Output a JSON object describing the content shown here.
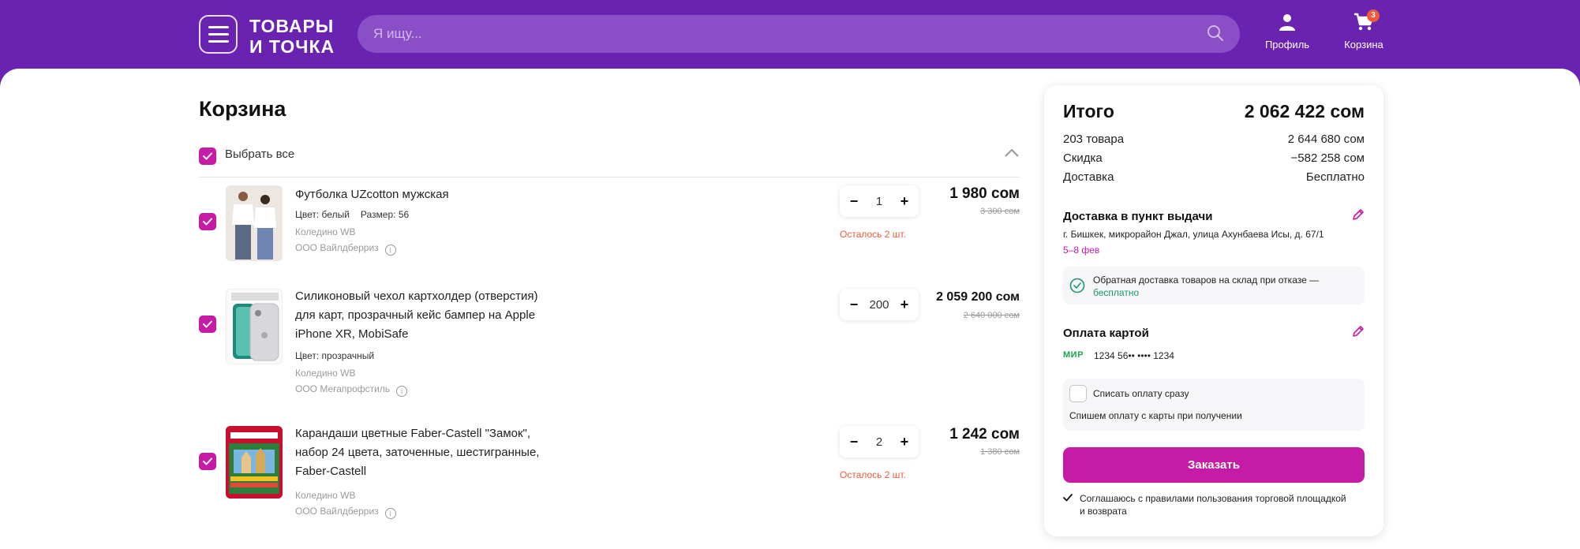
{
  "header": {
    "logo_line1": "ТОВАРЫ",
    "logo_line2": "И ТОЧКА",
    "search_placeholder": "Я ищу...",
    "profile_label": "Профиль",
    "cart_label": "Корзина",
    "cart_count": "3"
  },
  "cart": {
    "title": "Корзина",
    "select_all": "Выбрать все",
    "items": [
      {
        "name": "Футболка UZcotton мужская",
        "color": "Цвет: белый",
        "size": "Размер: 56",
        "warehouse": "Коледино WB",
        "seller": "ООО Вайлдберриз",
        "quantity": "1",
        "price": "1 980 сом",
        "old_price": "3 300 сом",
        "stock_note": "Осталось 2 шт."
      },
      {
        "name": "Силиконовый чехол картхолдер (отверстия) для карт, прозрачный кейс бампер на Apple iPhone XR, MobiSafe",
        "color": "Цвет: прозрачный",
        "warehouse": "Коледино WB",
        "seller": "ООО Мегапрофстиль",
        "quantity": "200",
        "price": "2 059 200 сом",
        "old_price": "2 640 000 сом"
      },
      {
        "name": "Карандаши цветные Faber-Castell \"Замок\", набор 24 цвета, заточенные, шестигранные, Faber-Castell",
        "warehouse": "Коледино WB",
        "seller": "ООО Вайлдберриз",
        "quantity": "2",
        "price": "1 242 сом",
        "old_price": "1 380 сом",
        "stock_note": "Осталось 2 шт."
      }
    ]
  },
  "summary": {
    "title": "Итого",
    "total": "2 062 422 сом",
    "rows": [
      {
        "label": "203 товара",
        "value": "2 644 680 сом"
      },
      {
        "label": "Скидка",
        "value": "−582 258 сом"
      },
      {
        "label": "Доставка",
        "value": "Бесплатно"
      }
    ],
    "delivery_title": "Доставка в пункт выдачи",
    "delivery_address": "г. Бишкек, микрорайон Джал, улица Ахунбаева Исы, д. 67/1",
    "delivery_dates": "5–8 фев",
    "return_text": "Обратная доставка товаров на склад при отказе —",
    "return_free": "бесплатно",
    "payment_title": "Оплата картой",
    "card_brand": "МИР",
    "card_number": "1234 56•• •••• 1234",
    "charge_now": "Списать оплату сразу",
    "charge_note": "Спишем оплату с карты при получении",
    "order_button": "Заказать",
    "agree_text": "Соглашаюсь с правилами пользования торговой площадкой и возврата"
  },
  "colors": {
    "header_bg": "#6a22b1",
    "accent": "#c51ba6",
    "stock_warning": "#f05a3a",
    "return_free": "#1a9a6a"
  }
}
